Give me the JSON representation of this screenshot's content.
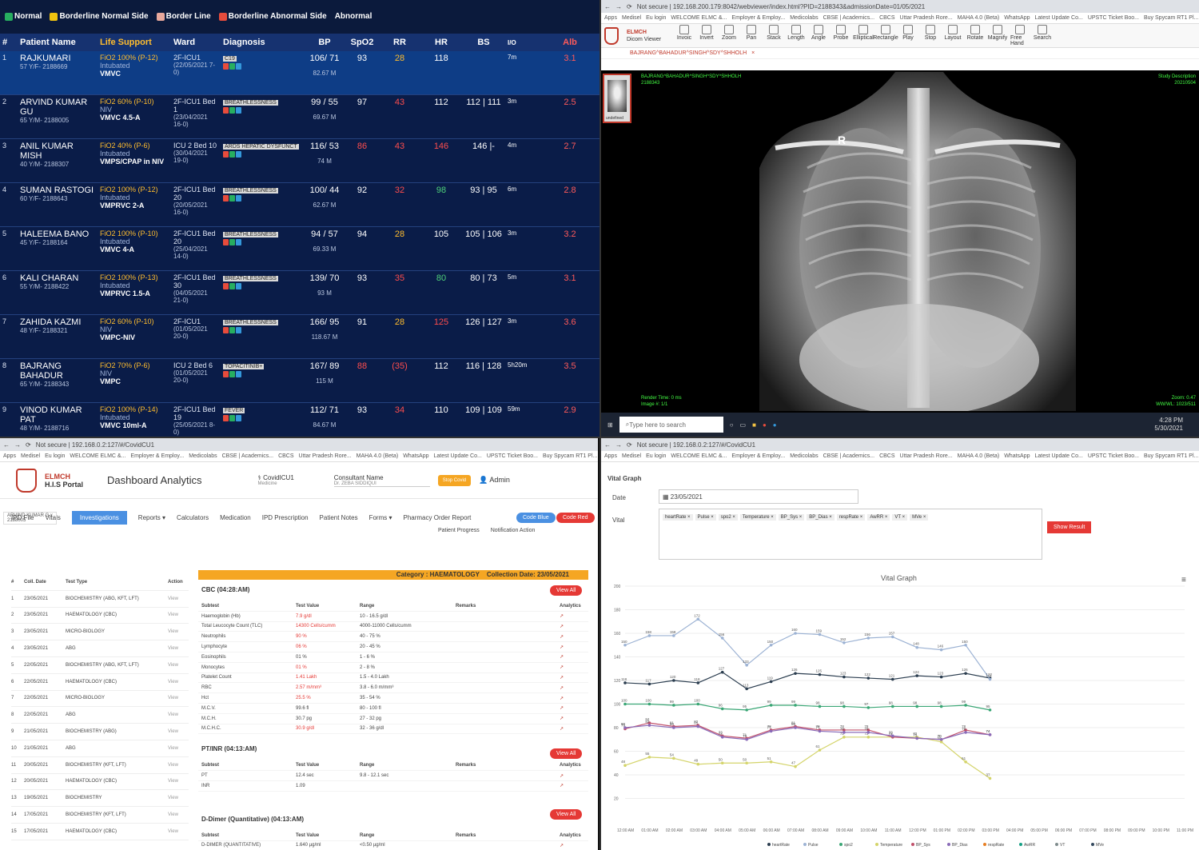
{
  "icu": {
    "legend": [
      {
        "label": "Normal",
        "color": "#27ae60"
      },
      {
        "label": "Borderline Normal Side",
        "color": "#f1c40f"
      },
      {
        "label": "Border Line",
        "color": "#e8a89c"
      },
      {
        "label": "Borderline Abnormal Side",
        "color": "#e74c3c"
      }
    ],
    "legend_last": "Abnormal",
    "headers": [
      "#",
      "Patient Name",
      "Life Support",
      "Ward",
      "Diagnosis",
      "BP",
      "SpO2",
      "RR",
      "HR",
      "BS",
      "I/O",
      "Alb"
    ],
    "rows": [
      {
        "n": "1",
        "name": "RAJKUMARI",
        "id": "57 Y/F- 2188669",
        "life1": "FiO2 100% (P-12)",
        "life2": "Intubated",
        "life3": "VMVC",
        "ward": "2F-ICU1",
        "wdate": "(22/05/2021 7-0)",
        "diag": "C19",
        "bp": "106/ 71",
        "bp2": "82.67 M",
        "sp": "93",
        "rr": "28",
        "hr": "118",
        "bs": "",
        "io": "7m",
        "alb": "3.1"
      },
      {
        "n": "2",
        "name": "ARVIND KUMAR GU",
        "id": "65 Y/M- 2188005",
        "life1": "FiO2 60% (P-10)",
        "life2": "NIV",
        "life3": "VMVC 4.5-A",
        "ward": "2F-ICU1 Bed 1",
        "wdate": "(23/04/2021 16-0)",
        "diag": "BREATHLESSNESS",
        "bp": "99 / 55",
        "bp2": "69.67 M",
        "sp": "97",
        "rr": "43",
        "hr": "112",
        "bs": "112 | 111",
        "io": "3m",
        "alb": "2.5"
      },
      {
        "n": "3",
        "name": "ANIL KUMAR MISH",
        "id": "40 Y/M- 2188307",
        "life1": "FiO2 40% (P-6)",
        "life2": "Intubated",
        "life3": "VMPS/CPAP in NIV",
        "ward": "ICU 2 Bed 10",
        "wdate": "(30/04/2021 19-0)",
        "diag": "ARDS  HEPATIC DYSFUNCT",
        "bp": "116/ 53",
        "bp2": "74 M",
        "sp": "86",
        "rr": "43",
        "hr": "146",
        "bs": "146 |-",
        "io": "4m",
        "alb": "2.7"
      },
      {
        "n": "4",
        "name": "SUMAN RASTOGI",
        "id": "60 Y/F- 2188643",
        "life1": "FiO2 100% (P-12)",
        "life2": "Intubated",
        "life3": "VMPRVC 2-A",
        "ward": "2F-ICU1 Bed 20",
        "wdate": "(20/05/2021 16-0)",
        "diag": "BREATHLESSNESS",
        "bp": "100/ 44",
        "bp2": "62.67 M",
        "sp": "92",
        "rr": "32",
        "hr": "98",
        "bs": "93 | 95",
        "io": "6m",
        "alb": "2.8"
      },
      {
        "n": "5",
        "name": "HALEEMA BANO",
        "id": "45 Y/F- 2188164",
        "life1": "FiO2 100% (P-10)",
        "life2": "Intubated",
        "life3": "VMVC 4-A",
        "ward": "2F-ICU1 Bed 20",
        "wdate": "(25/04/2021 14-0)",
        "diag": "BREATHLESSNESS",
        "bp": "94 / 57",
        "bp2": "69.33 M",
        "sp": "94",
        "rr": "28",
        "hr": "105",
        "bs": "105 | 106",
        "io": "3m",
        "alb": "3.2"
      },
      {
        "n": "6",
        "name": "KALI CHARAN",
        "id": "55 Y/M- 2188422",
        "life1": "FiO2 100% (P-13)",
        "life2": "Intubated",
        "life3": "VMPRVC 1.5-A",
        "ward": "2F-ICU1 Bed 30",
        "wdate": "(04/05/2021 21-0)",
        "diag": "BREATHLESSNESS",
        "bp": "139/ 70",
        "bp2": "93 M",
        "sp": "93",
        "rr": "35",
        "hr": "80",
        "bs": "80 | 73",
        "io": "5m",
        "alb": "3.1"
      },
      {
        "n": "7",
        "name": "ZAHIDA KAZMI",
        "id": "48 Y/F- 2188321",
        "life1": "FiO2 60% (P-10)",
        "life2": "NIV",
        "life3": "VMPC-NIV",
        "ward": "2F-ICU1",
        "wdate": "(01/05/2021 20-0)",
        "diag": "BREATHLESSNESS",
        "bp": "166/ 95",
        "bp2": "118.67 M",
        "sp": "91",
        "rr": "28",
        "hr": "125",
        "bs": "126 | 127",
        "io": "3m",
        "alb": "3.6"
      },
      {
        "n": "8",
        "name": "BAJRANG BAHADUR",
        "id": "65 Y/M- 2188343",
        "life1": "FiO2 70% (P-6)",
        "life2": "NIV",
        "life3": "VMPC",
        "ward": "ICU 2 Bed 6",
        "wdate": "(01/05/2021 20-0)",
        "diag": "TOPACITINIB+",
        "bp": "167/ 89",
        "bp2": "115 M",
        "sp": "88",
        "rr": "(35)",
        "hr": "112",
        "bs": "116 | 128",
        "io": "5h20m",
        "alb": "3.5"
      },
      {
        "n": "9",
        "name": "VINOD KUMAR PAT",
        "id": "48 Y/M- 2188716",
        "life1": "FiO2 100% (P-14)",
        "life2": "Intubated",
        "life3": "VMVC 10ml-A",
        "ward": "2F-ICU1 Bed 19",
        "wdate": "(25/05/2021 8-0)",
        "diag": "FEVER",
        "bp": "112/ 71",
        "bp2": "84.67 M",
        "sp": "93",
        "rr": "34",
        "hr": "110",
        "bs": "109 | 109",
        "io": "59m",
        "alb": "2.9"
      }
    ]
  },
  "dicom": {
    "tab": "Not secure | 192.168.200.179:8042/webviewer/index.html?PID=2188343&admissionDate=01/05/2021",
    "bookmarks": [
      "Apps",
      "Medisel",
      "Eu login",
      "WELCOME ELMC &...",
      "Employer & Employ...",
      "Medicolabs",
      "CBSE | Academics...",
      "CBCS",
      "Uttar Pradesh Rore...",
      "MAHA 4.0 (Beta)",
      "WhatsApp",
      "Latest Update Co...",
      "UPSTC Ticket Boo...",
      "Buy Spycam RT1 Pl..."
    ],
    "brand": "ELMCH",
    "brand_sub": "Dicom Viewer",
    "tools": [
      "Invoic",
      "Invert",
      "Zoom",
      "Pan",
      "Stack",
      "Length",
      "Angle",
      "Probe",
      "Elliptical",
      "Rectangle",
      "Play",
      "Stop",
      "Layout",
      "Rotate",
      "Magnify",
      "Free Hand",
      "Search"
    ],
    "study": "BAJRANG^BAHADUR^SINGH^SDY^SHHOLH",
    "thumb_label": "undefined",
    "overlay_tl": "BAJRANG^BAHADUR^SINGH^SDY^SHHOLH",
    "overlay_id": "2188343",
    "overlay_tr": "Study Description",
    "overlay_tr2": "20210504",
    "render": "Render Time: 0 ms",
    "image": "Image #: 1/1",
    "zoom": "Zoom: 0.47",
    "ww": "WW/WL: 1023/511",
    "marker": "R",
    "search_placeholder": "Type here to search",
    "time": "4:28 PM",
    "date": "5/30/2021"
  },
  "dashboard": {
    "address": "Not secure | 192.168.0.2:127/#/CovidCU1",
    "brand": "ELMCH",
    "brand_sub": "H.I.S Portal",
    "title": "Dashboard Analytics",
    "dept": "CovidICU1",
    "dept_sub": "Medicine",
    "consultant_label": "Consultant Name",
    "consultant": "Dr. ZEBA SIDDIQUI",
    "stop_covid": "Stop Covid",
    "user": "Admin",
    "code_blue": "Code Blue",
    "code_red": "Code Red",
    "patient_tab": "ARVIND KUMAR G x",
    "patient_id": "2188005",
    "menu": [
      "IPD File",
      "Vitals",
      "Investigations",
      "Reports ▾",
      "Calculators",
      "Medication",
      "IPD Prescription",
      "Patient Notes",
      "Forms ▾",
      "Pharmacy Order Report"
    ],
    "menu2": [
      "Patient Progress",
      "Notification Action"
    ],
    "list_headers": [
      "#",
      "Coll. Date",
      "Test Type",
      "Action"
    ],
    "list": [
      [
        "1",
        "23/05/2021",
        "BIOCHEMISTRY (ABG, KFT, LFT)",
        "View"
      ],
      [
        "2",
        "23/05/2021",
        "HAEMATOLOGY (CBC)",
        "View"
      ],
      [
        "3",
        "23/05/2021",
        "MICRO-BIOLOGY",
        "View"
      ],
      [
        "4",
        "23/05/2021",
        "ABG",
        "View"
      ],
      [
        "5",
        "22/05/2021",
        "BIOCHEMISTRY (ABG, KFT, LFT)",
        "View"
      ],
      [
        "6",
        "22/05/2021",
        "HAEMATOLOGY (CBC)",
        "View"
      ],
      [
        "7",
        "22/05/2021",
        "MICRO-BIOLOGY",
        "View"
      ],
      [
        "8",
        "22/05/2021",
        "ABG",
        "View"
      ],
      [
        "9",
        "21/05/2021",
        "BIOCHEMISTRY (ABG)",
        "View"
      ],
      [
        "10",
        "21/05/2021",
        "ABG",
        "View"
      ],
      [
        "11",
        "20/05/2021",
        "BIOCHEMISTRY (KFT, LFT)",
        "View"
      ],
      [
        "12",
        "20/05/2021",
        "HAEMATOLOGY (CBC)",
        "View"
      ],
      [
        "13",
        "19/05/2021",
        "BIOCHEMISTRY",
        "View"
      ],
      [
        "14",
        "17/05/2021",
        "BIOCHEMISTRY (KFT, LFT)",
        "View"
      ],
      [
        "15",
        "17/05/2021",
        "HAEMATOLOGY (CBC)",
        "View"
      ]
    ],
    "category": "Category : HAEMATOLOGY",
    "collection": "Collection Date: 23/05/2021",
    "cbc_title": "CBC  (04:28:AM)",
    "view_all": "View All",
    "lab_headers": [
      "Subtest",
      "Test Value",
      "Range",
      "Remarks",
      "Analytics"
    ],
    "cbc": [
      [
        "Haemoglobin (Hb)",
        "7.9 g/dl",
        "10 - 16.5 g/dl"
      ],
      [
        "Total Leucocyte Count (TLC)",
        "14300 Cells/cumm",
        "4000-11000 Cells/cumm"
      ],
      [
        "Neutrophils",
        "90 %",
        "40 - 75 %"
      ],
      [
        "Lymphocyte",
        "06 %",
        "20 - 45 %"
      ],
      [
        "Eosinophils",
        "01 %",
        "1 - 6 %"
      ],
      [
        "Monocytes",
        "01 %",
        "2 - 8 %"
      ],
      [
        "Platelet Count",
        "1.41 Lakh",
        "1.5 - 4.0 Lakh"
      ],
      [
        "RBC",
        "2.57 m/mm³",
        "3.8 - 6.0 m/mm³"
      ],
      [
        "Hct",
        "25.5 %",
        "35 - 54 %"
      ],
      [
        "M.C.V.",
        "99.6 fl",
        "80 - 100 fl"
      ],
      [
        "M.C.H.",
        "30.7 pg",
        "27 - 32 pg"
      ],
      [
        "M.C.H.C.",
        "30.9 g/dl",
        "32 - 36 g/dl"
      ]
    ],
    "pt_title": "PT/INR  (04:13:AM)",
    "pt": [
      [
        "PT",
        "12.4 sec",
        "9.8 - 12.1 sec"
      ],
      [
        "INR",
        "1.09",
        ""
      ]
    ],
    "dd_title": "D-Dimer (Quantitative)  (04:13:AM)",
    "dd": [
      [
        "D-DIMER (QUANTITATIVE)",
        "1.640 µg/ml",
        "<0.50 µg/ml"
      ]
    ]
  },
  "vitals": {
    "address": "Not secure | 192.168.0.2:127/#/CovidCU1",
    "section": "Vital Graph",
    "date_label": "Date",
    "date": "23/05/2021",
    "vital_label": "Vital",
    "chips": [
      "heartRate ×",
      "Pulse ×",
      "spo2 ×",
      "Temperature ×",
      "BP_Sys ×",
      "BP_Dias ×",
      "respRate ×",
      "AwRR ×",
      "VT ×",
      "MVe ×"
    ],
    "show_result": "Show Result",
    "chart_title": "Vital Graph"
  },
  "chart_data": {
    "type": "line",
    "title": "Vital Graph",
    "ylim": [
      0,
      200
    ],
    "yticks": [
      "200",
      "180",
      "160",
      "140",
      "120",
      "100",
      "80",
      "60",
      "40",
      "20"
    ],
    "x": [
      "12:00 AM",
      "01:00 AM",
      "02:00 AM",
      "03:00 AM",
      "04:00 AM",
      "05:00 AM",
      "06:00 AM",
      "07:00 AM",
      "08:00 AM",
      "09:00 AM",
      "10:00 AM",
      "11:00 AM",
      "12:00 PM",
      "01:00 PM",
      "02:00 PM",
      "03:00 PM",
      "04:00 PM",
      "05:00 PM",
      "06:00 PM",
      "07:00 PM",
      "08:00 PM",
      "09:00 PM",
      "10:00 PM",
      "11:00 PM"
    ],
    "series": [
      {
        "name": "heartRate",
        "color": "#2c3e50",
        "values": [
          118,
          117,
          120,
          118,
          127,
          113,
          119,
          126,
          125,
          123,
          122,
          121,
          124,
          123,
          126,
          122
        ]
      },
      {
        "name": "Pulse",
        "color": "#9db3d4",
        "values": [
          150,
          158,
          158,
          172,
          156,
          133,
          150,
          160,
          159,
          152,
          156,
          157,
          148,
          146,
          150,
          121
        ]
      },
      {
        "name": "spo2",
        "color": "#3aa675",
        "values": [
          100,
          100,
          99,
          100,
          96,
          95,
          99,
          99,
          98,
          98,
          97,
          98,
          98,
          98,
          99,
          95
        ]
      },
      {
        "name": "Temperature",
        "color": "#d4d46a",
        "values": [
          48,
          55,
          54,
          49,
          50,
          50,
          51,
          47,
          61,
          72,
          72,
          72,
          72,
          68,
          51,
          37
        ]
      },
      {
        "name": "BP_Sys",
        "color": "#c0506a",
        "values": [
          79,
          84,
          81,
          82,
          73,
          71,
          78,
          81,
          78,
          78,
          78,
          72,
          71,
          70,
          78,
          74
        ]
      },
      {
        "name": "BP_Dias",
        "color": "#8a6bb8",
        "values": [
          80,
          82,
          80,
          81,
          72,
          70,
          77,
          80,
          77,
          76,
          76,
          73,
          71,
          70,
          76,
          74
        ]
      }
    ],
    "legend": [
      "heartRate",
      "Pulse",
      "spo2",
      "Temperature",
      "BP_Sys",
      "BP_Dias",
      "respRate",
      "AwRR",
      "VT",
      "MVe"
    ]
  }
}
